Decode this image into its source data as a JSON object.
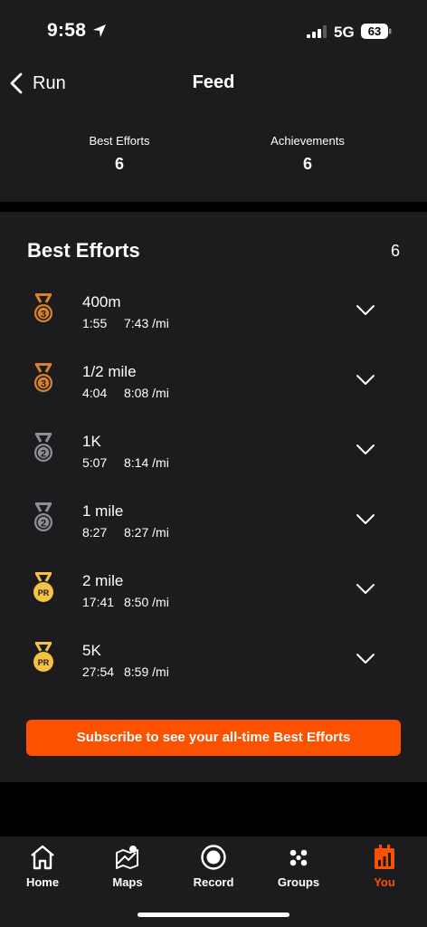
{
  "status": {
    "time": "9:58",
    "network": "5G",
    "battery": "63"
  },
  "nav": {
    "back_label": "Run",
    "title": "Feed"
  },
  "summary": [
    {
      "label": "Best Efforts",
      "value": "6"
    },
    {
      "label": "Achievements",
      "value": "6"
    }
  ],
  "best_efforts": {
    "title": "Best Efforts",
    "count": "6",
    "items": [
      {
        "name": "400m",
        "time": "1:55",
        "pace": "7:43 /mi",
        "medal": "bronze-3"
      },
      {
        "name": "1/2 mile",
        "time": "4:04",
        "pace": "8:08 /mi",
        "medal": "bronze-3"
      },
      {
        "name": "1K",
        "time": "5:07",
        "pace": "8:14 /mi",
        "medal": "silver-2"
      },
      {
        "name": "1 mile",
        "time": "8:27",
        "pace": "8:27 /mi",
        "medal": "silver-2"
      },
      {
        "name": "2 mile",
        "time": "17:41",
        "pace": "8:50 /mi",
        "medal": "gold-pr"
      },
      {
        "name": "5K",
        "time": "27:54",
        "pace": "8:59 /mi",
        "medal": "gold-pr"
      }
    ],
    "subscribe_label": "Subscribe to see your all-time Best Efforts"
  },
  "tabs": [
    {
      "label": "Home",
      "icon": "home-icon"
    },
    {
      "label": "Maps",
      "icon": "maps-icon"
    },
    {
      "label": "Record",
      "icon": "record-icon"
    },
    {
      "label": "Groups",
      "icon": "groups-icon"
    },
    {
      "label": "You",
      "icon": "you-icon",
      "active": true
    }
  ],
  "colors": {
    "accent": "#fc5200",
    "background": "#000000",
    "surface": "#1c1c1e",
    "bronze": "#d9822b",
    "silver": "#8e8e93",
    "gold": "#f6c244"
  }
}
